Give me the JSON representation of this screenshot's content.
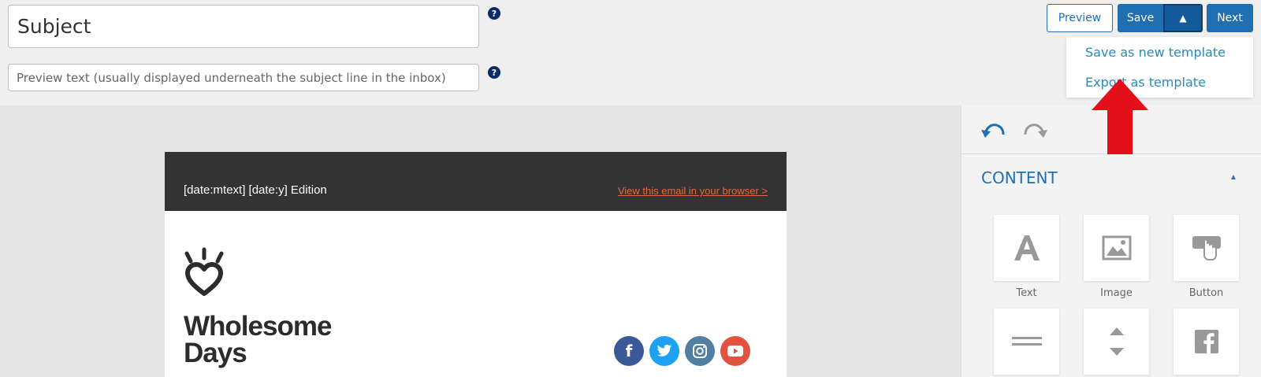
{
  "header": {
    "subject_value": "Subject",
    "preview_text_placeholder": "Preview text (usually displayed underneath the subject line in the inbox)",
    "help_glyph": "?"
  },
  "toolbar": {
    "preview_label": "Preview",
    "save_label": "Save",
    "caret_glyph": "▲",
    "next_label": "Next",
    "accent_color": "#1f6fb2"
  },
  "save_menu": {
    "items": [
      "Save as new template",
      "Export as template"
    ]
  },
  "email": {
    "edition": "[date:mtext] [date:y] Edition",
    "view_link": "View this email in your browser >",
    "brand_line1": "Wholesome",
    "brand_line2": "Days",
    "social_icons": [
      "facebook-icon",
      "twitter-icon",
      "instagram-icon",
      "youtube-icon"
    ]
  },
  "panel": {
    "content_title": "CONTENT",
    "collapse_glyph": "▲",
    "blocks": [
      {
        "label": "Text",
        "icon": "text-icon"
      },
      {
        "label": "Image",
        "icon": "image-icon"
      },
      {
        "label": "Button",
        "icon": "button-icon"
      },
      {
        "label": "",
        "icon": "divider-icon"
      },
      {
        "label": "",
        "icon": "spacer-icon"
      },
      {
        "label": "",
        "icon": "facebook-icon"
      }
    ]
  }
}
